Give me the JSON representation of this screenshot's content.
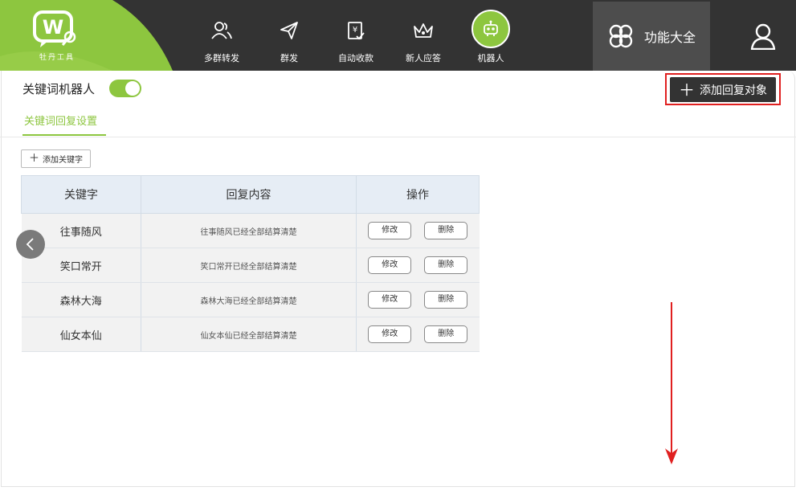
{
  "brand": {
    "logo_text": "牡丹工具",
    "colors": {
      "green": "#8dc63f",
      "topbar": "#333333",
      "red": "#e02020"
    }
  },
  "nav": [
    {
      "label": "多群转发",
      "icon": "users-icon"
    },
    {
      "label": "群发",
      "icon": "send-icon"
    },
    {
      "label": "自动收款",
      "icon": "payment-icon"
    },
    {
      "label": "新人应答",
      "icon": "crown-icon"
    },
    {
      "label": "机器人",
      "icon": "robot-icon",
      "active": true
    }
  ],
  "func_menu": {
    "label": "功能大全",
    "icon": "clover-icon"
  },
  "user": {
    "icon": "user-icon"
  },
  "page": {
    "robot_title": "关键词机器人",
    "robot_enabled": true,
    "add_target_label": "添加回复对象",
    "tab_label": "关键词回复设置",
    "add_keyword_label": "添加关键字"
  },
  "table": {
    "headers": [
      "关键字",
      "回复内容",
      "操作"
    ],
    "edit_label": "修改",
    "delete_label": "删除",
    "rows": [
      {
        "keyword": "往事随风",
        "reply": "往事随风已经全部结算清楚"
      },
      {
        "keyword": "笑口常开",
        "reply": "笑口常开已经全部结算清楚"
      },
      {
        "keyword": "森林大海",
        "reply": "森林大海已经全部结算清楚"
      },
      {
        "keyword": "仙女本仙",
        "reply": "仙女本仙已经全部结算清楚"
      }
    ]
  }
}
